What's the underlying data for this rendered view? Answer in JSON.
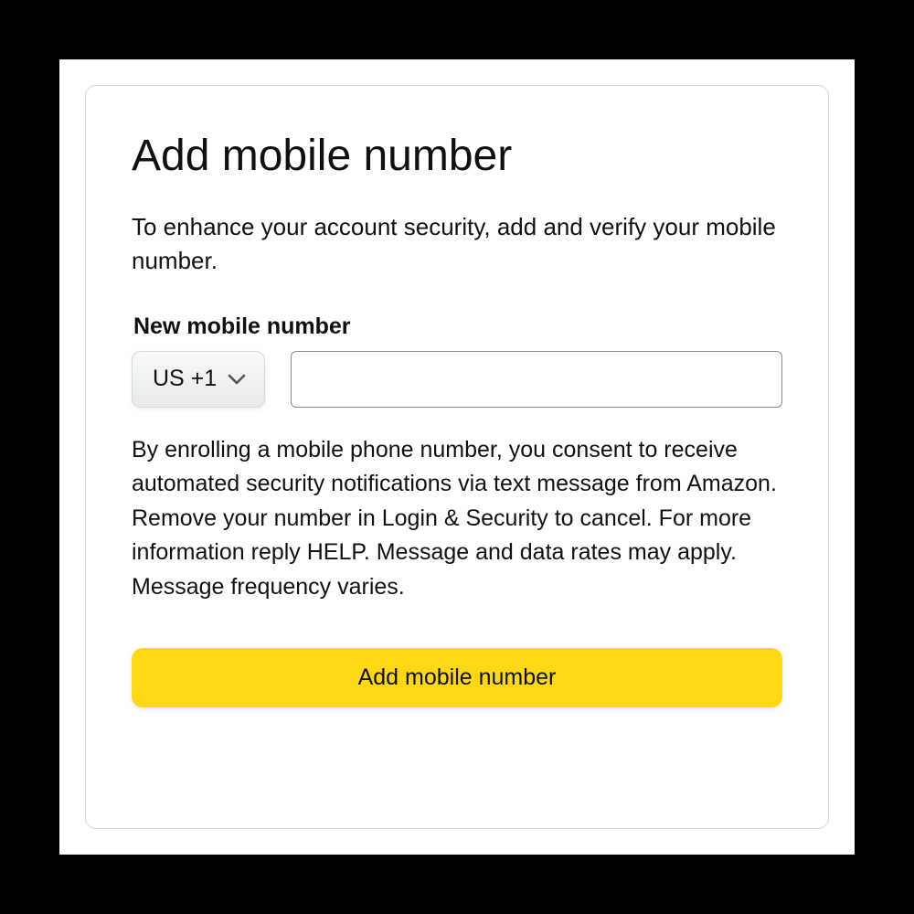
{
  "title": "Add mobile number",
  "subtitle": "To enhance your account security, add and verify your mobile number.",
  "field_label": "New mobile number",
  "country_code": "US +1",
  "phone_value": "",
  "disclaimer": "By enrolling a mobile phone number, you consent to receive automated security notifications via text message from Amazon. Remove your number in Login & Security to cancel. For more information reply HELP. Message and data rates may apply. Message frequency varies.",
  "submit_label": "Add mobile number",
  "colors": {
    "accent": "#ffd814"
  }
}
